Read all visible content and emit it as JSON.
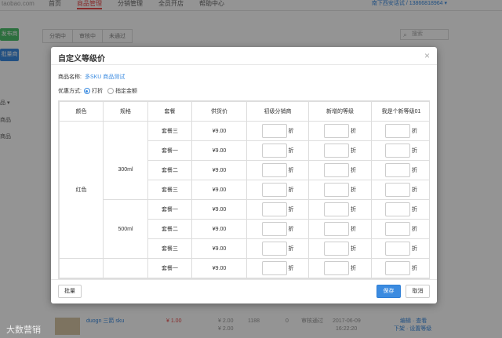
{
  "background": {
    "logo": "taobao.com",
    "nav": [
      "首页",
      "商品管理",
      "分销管理",
      "全员开店",
      "帮助中心"
    ],
    "nav_active_index": 1,
    "user": "南下西安话试 / 13866818964 ▾",
    "side_btn1": "发布商品",
    "side_btn2": "批量商品",
    "side_items": [
      "品 ▾",
      "商品",
      "商品"
    ],
    "tabs": [
      "分销中",
      "审核中",
      "未通过"
    ],
    "search_placeholder": "搜索",
    "row": {
      "name": "duogn 三箭 sku",
      "price_red": "¥ 1.00",
      "price_a": "¥ 2.00",
      "price_b": "¥ 2.00",
      "stock": "1188",
      "sold": "0",
      "status": "审核通过",
      "date": "2017-06-09",
      "time": "16:22:20",
      "ops": "编辑 · 查看",
      "ops2": "下架 · 设置等级"
    }
  },
  "watermark": "大数营销",
  "modal": {
    "title": "自定义等级价",
    "product_label": "商品名称:",
    "product_name": "多SKU 商品测试",
    "discount_label": "优惠方式:",
    "option_discount": "打折",
    "option_amount": "指定金额",
    "selected_option": "打折",
    "columns": [
      "颜色",
      "规格",
      "套餐",
      "供货价",
      "初级分销商",
      "新增的等级",
      "我是个新等级01"
    ],
    "unit": "折",
    "rows": [
      {
        "package": "套餐三",
        "price": "¥9.00"
      },
      {
        "package": "套餐一",
        "price": "¥9.00"
      },
      {
        "package": "套餐二",
        "price": "¥9.00"
      },
      {
        "package": "套餐三",
        "price": "¥9.00"
      },
      {
        "package": "套餐一",
        "price": "¥9.00"
      },
      {
        "package": "套餐二",
        "price": "¥9.00"
      },
      {
        "package": "套餐三",
        "price": "¥9.00"
      },
      {
        "package": "套餐一",
        "price": "¥9.00"
      }
    ],
    "color_value": "红色",
    "spec_300": "300ml",
    "spec_500": "500ml",
    "batch_button": "批量",
    "save_button": "保存",
    "cancel_button": "取消"
  }
}
